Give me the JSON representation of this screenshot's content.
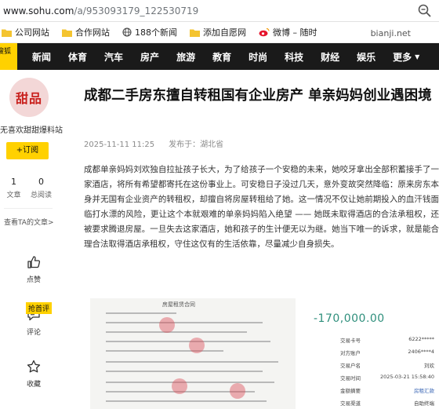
{
  "browser": {
    "url_host": "www.sohu.com",
    "url_path": "/a/953093179_122530719",
    "zoom_icon": "zoom-icon"
  },
  "bookmarks": [
    {
      "label": "公司网站",
      "icon": "folder-icon"
    },
    {
      "label": "合作网站",
      "icon": "folder-icon"
    },
    {
      "label": "188个新闻",
      "icon": "globe-icon"
    },
    {
      "label": "添加自愿网",
      "icon": "folder-icon"
    },
    {
      "label": "微博 – 随时",
      "icon": "weibo-icon"
    }
  ],
  "bookmark_right": "bianji.net",
  "nav": {
    "logo_text": "搜狐",
    "items": [
      "新闻",
      "体育",
      "汽车",
      "房产",
      "旅游",
      "教育",
      "时尚",
      "科技",
      "财经",
      "娱乐"
    ],
    "more": "更多"
  },
  "sidebar": {
    "avatar_text": "甜品",
    "author": "无喜欢甜甜爆料站",
    "subscribe": "+订阅",
    "stats": [
      {
        "value": "1",
        "label": "文章"
      },
      {
        "value": "0",
        "label": "总阅读"
      }
    ],
    "more_link": "查看TA的文章>",
    "actions": [
      {
        "label": "点赞",
        "icon": "thumbs-up-icon"
      },
      {
        "label": "评论",
        "icon": "comment-icon"
      },
      {
        "label": "收藏",
        "icon": "star-icon"
      }
    ],
    "comment_tag": "抢首评"
  },
  "article": {
    "title": "成都二手房东擅自转租国有企业房产 单亲妈妈创业遇困境",
    "date": "2025-11-11 11:25",
    "source": "发布于：湖北省",
    "body": "成都单亲妈妈刘欢独自拉扯孩子长大，为了给孩子一个安稳的未来，她咬牙拿出全部积蓄接手了一家酒店，将所有希望都寄托在这份事业上。可安稳日子没过几天，意外变故突然降临：原来房东本身并无国有企业资产的转租权，却擅自将房屋转租给了她。这一情况不仅让她前期投入的血汗钱面临打水漂的风险，更让这个本就艰难的单亲妈妈陷入绝望 —— 她既未取得酒店的合法承租权，还被要求腾退房屋。一旦失去这家酒店，她和孩子的生计便无以为继。她当下唯一的诉求，就是能合理合法取得酒店承租权，守住这仅有的生活依靠，尽量减少自身损失。"
  },
  "image": {
    "contract_title": "房屋租赁合同",
    "receipt": {
      "amount": "-170,000.00",
      "rows": [
        {
          "key": "交易卡号",
          "value": "6222*****"
        },
        {
          "key": "对方账户",
          "value": "2406****4"
        },
        {
          "key": "交易户名",
          "value": "刘欢"
        },
        {
          "key": "交易时间",
          "value": "2025-03-21 15:58:40"
        },
        {
          "key": "金额摘要",
          "value": "房租汇款"
        },
        {
          "key": "交易渠道",
          "value": "自助终端"
        }
      ]
    }
  }
}
